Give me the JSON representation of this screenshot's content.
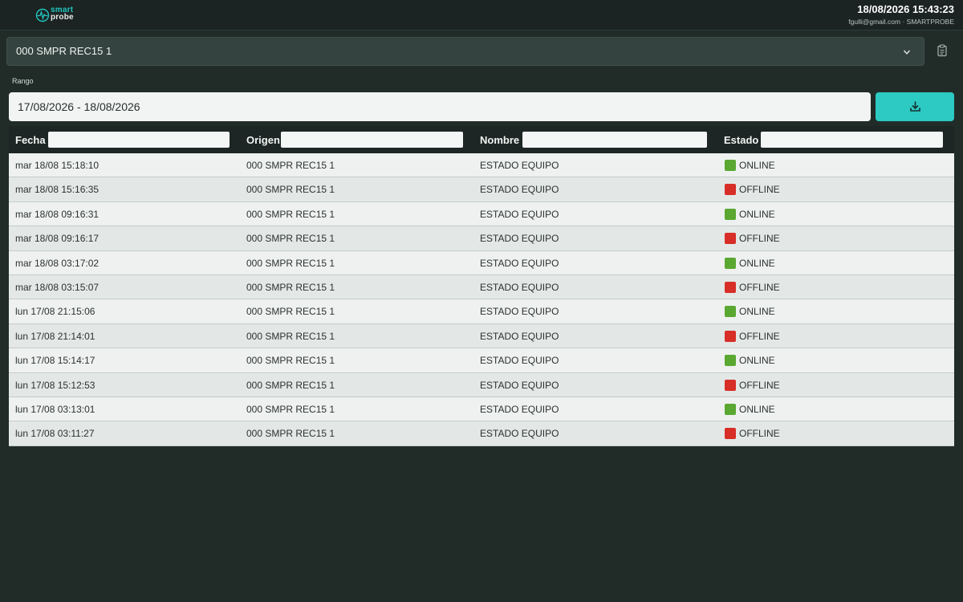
{
  "header": {
    "logo_line1": "smart",
    "logo_line2": "probe",
    "datetime": "18/08/2026 15:43:23",
    "user": "fgulli@gmail.com · SMARTPROBE"
  },
  "device_select": {
    "value": "000 SMPR REC15 1",
    "icon": "chevron-down-icon"
  },
  "clipboard_icon": "clipboard-icon",
  "range": {
    "label": "Rango",
    "value": "17/08/2026 - 18/08/2026"
  },
  "download_button": {
    "icon": "download-icon"
  },
  "colors": {
    "accent": "#2ccac3",
    "online": "#5aa831",
    "offline": "#d82e28",
    "background": "#212c29"
  },
  "table": {
    "columns": [
      "Fecha",
      "Origen",
      "Nombre",
      "Estado"
    ],
    "rows": [
      {
        "fecha": "mar 18/08 15:18:10",
        "origen": "000 SMPR REC15 1",
        "nombre": "ESTADO EQUIPO",
        "estado": "ONLINE"
      },
      {
        "fecha": "mar 18/08 15:16:35",
        "origen": "000 SMPR REC15 1",
        "nombre": "ESTADO EQUIPO",
        "estado": "OFFLINE"
      },
      {
        "fecha": "mar 18/08 09:16:31",
        "origen": "000 SMPR REC15 1",
        "nombre": "ESTADO EQUIPO",
        "estado": "ONLINE"
      },
      {
        "fecha": "mar 18/08 09:16:17",
        "origen": "000 SMPR REC15 1",
        "nombre": "ESTADO EQUIPO",
        "estado": "OFFLINE"
      },
      {
        "fecha": "mar 18/08 03:17:02",
        "origen": "000 SMPR REC15 1",
        "nombre": "ESTADO EQUIPO",
        "estado": "ONLINE"
      },
      {
        "fecha": "mar 18/08 03:15:07",
        "origen": "000 SMPR REC15 1",
        "nombre": "ESTADO EQUIPO",
        "estado": "OFFLINE"
      },
      {
        "fecha": "lun 17/08 21:15:06",
        "origen": "000 SMPR REC15 1",
        "nombre": "ESTADO EQUIPO",
        "estado": "ONLINE"
      },
      {
        "fecha": "lun 17/08 21:14:01",
        "origen": "000 SMPR REC15 1",
        "nombre": "ESTADO EQUIPO",
        "estado": "OFFLINE"
      },
      {
        "fecha": "lun 17/08 15:14:17",
        "origen": "000 SMPR REC15 1",
        "nombre": "ESTADO EQUIPO",
        "estado": "ONLINE"
      },
      {
        "fecha": "lun 17/08 15:12:53",
        "origen": "000 SMPR REC15 1",
        "nombre": "ESTADO EQUIPO",
        "estado": "OFFLINE"
      },
      {
        "fecha": "lun 17/08 03:13:01",
        "origen": "000 SMPR REC15 1",
        "nombre": "ESTADO EQUIPO",
        "estado": "ONLINE"
      },
      {
        "fecha": "lun 17/08 03:11:27",
        "origen": "000 SMPR REC15 1",
        "nombre": "ESTADO EQUIPO",
        "estado": "OFFLINE"
      }
    ]
  }
}
